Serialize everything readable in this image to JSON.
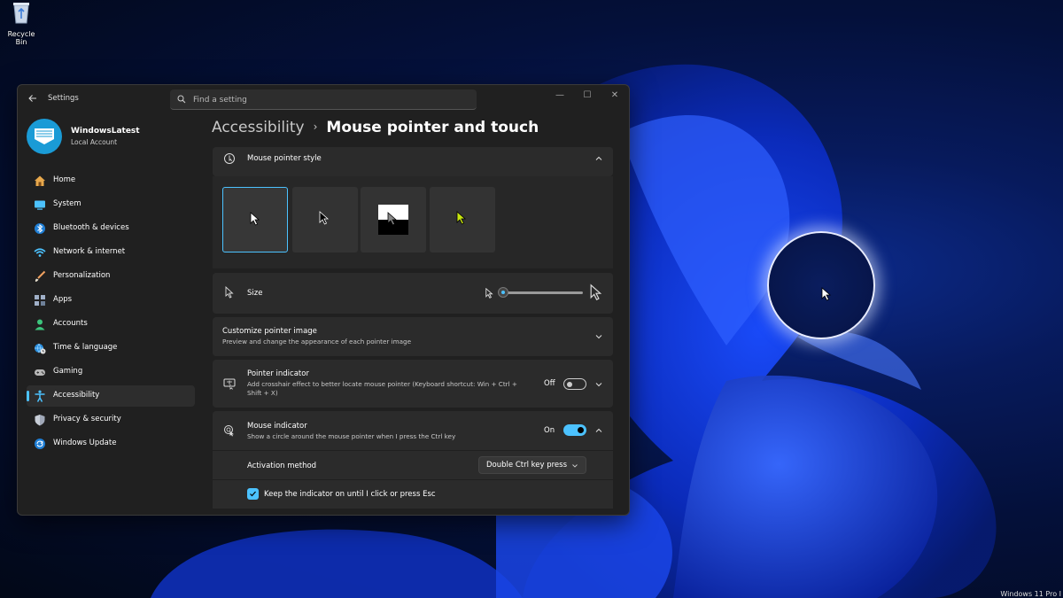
{
  "desktop": {
    "recycle_bin_label": "Recycle Bin",
    "watermark": "Windows 11 Pro I"
  },
  "window": {
    "app_title": "Settings",
    "search_placeholder": "Find a setting",
    "controls": {
      "minimize": "—",
      "maximize": "☐",
      "close": "✕"
    }
  },
  "profile": {
    "name": "WindowsLatest",
    "account_type": "Local Account"
  },
  "sidebar": {
    "items": [
      {
        "label": "Home",
        "icon": "home-icon",
        "color": "#e8a84c"
      },
      {
        "label": "System",
        "icon": "monitor-icon",
        "color": "#4cc2ff"
      },
      {
        "label": "Bluetooth & devices",
        "icon": "bluetooth-icon",
        "color": "#4cc2ff"
      },
      {
        "label": "Network & internet",
        "icon": "wifi-icon",
        "color": "#4cc2ff"
      },
      {
        "label": "Personalization",
        "icon": "brush-icon",
        "color": "#f0a060"
      },
      {
        "label": "Apps",
        "icon": "apps-icon",
        "color": "#a0b0c8"
      },
      {
        "label": "Accounts",
        "icon": "person-icon",
        "color": "#3cc47c"
      },
      {
        "label": "Time & language",
        "icon": "globe-clock-icon",
        "color": "#4cc2ff"
      },
      {
        "label": "Gaming",
        "icon": "gamepad-icon",
        "color": "#b8b8b8"
      },
      {
        "label": "Accessibility",
        "icon": "accessibility-icon",
        "color": "#4cc2ff",
        "active": true
      },
      {
        "label": "Privacy & security",
        "icon": "shield-icon",
        "color": "#a0a8b8"
      },
      {
        "label": "Windows Update",
        "icon": "update-icon",
        "color": "#4cc2ff"
      }
    ]
  },
  "breadcrumb": {
    "parent": "Accessibility",
    "separator": "›",
    "current": "Mouse pointer and touch"
  },
  "settings": {
    "pointer_style": {
      "title": "Mouse pointer style",
      "styles": [
        "white",
        "black",
        "inverted",
        "custom"
      ],
      "selected": "white",
      "custom_color": "#c8e610"
    },
    "size": {
      "title": "Size",
      "value": 1,
      "min": 1,
      "max": 15
    },
    "customize": {
      "title": "Customize pointer image",
      "description": "Preview and change the appearance of each pointer image"
    },
    "pointer_indicator": {
      "title": "Pointer indicator",
      "description": "Add crosshair effect to better locate mouse pointer (Keyboard shortcut: Win + Ctrl + Shift + X)",
      "state": "Off"
    },
    "mouse_indicator": {
      "title": "Mouse indicator",
      "description": "Show a circle around the mouse pointer when I press the Ctrl key",
      "state": "On"
    },
    "activation": {
      "label": "Activation method",
      "selected": "Double Ctrl key press"
    },
    "keep_indicator": {
      "label": "Keep the indicator on until I click or press Esc",
      "checked": true
    }
  },
  "colors": {
    "accent": "#4cc2ff",
    "window_bg": "#202020",
    "card_bg": "#2b2b2b"
  }
}
